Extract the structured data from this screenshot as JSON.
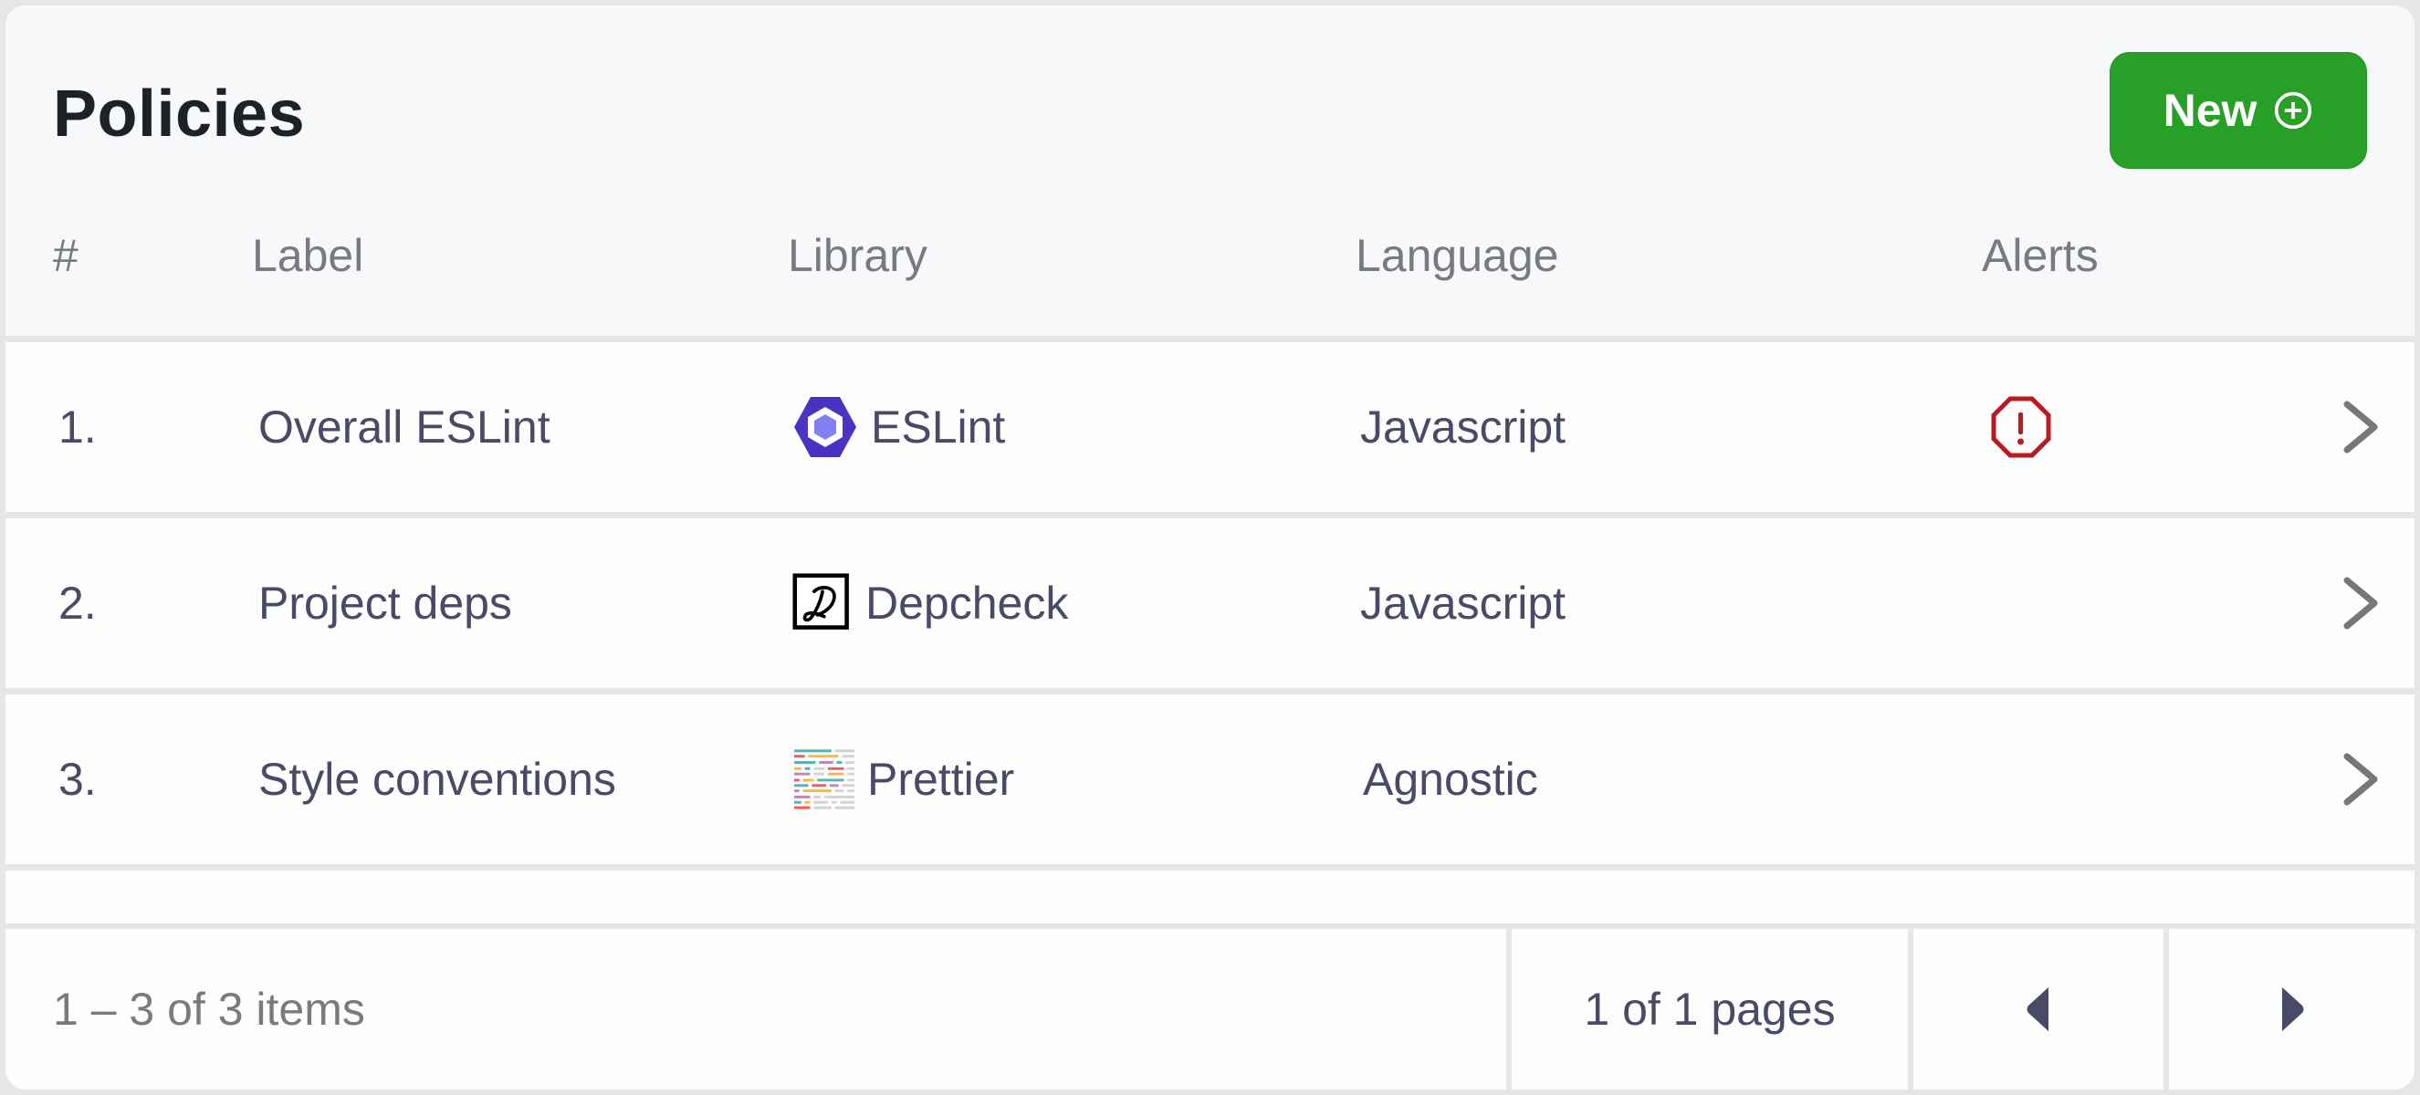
{
  "header": {
    "title": "Policies",
    "new_button_label": "New",
    "new_button_icon": "plus-circle-icon"
  },
  "columns": [
    "#",
    "Label",
    "Library",
    "Language",
    "Alerts"
  ],
  "rows": [
    {
      "index": "1.",
      "label": "Overall ESLint",
      "library": "ESLint",
      "library_icon": "eslint-logo-icon",
      "language": "Javascript",
      "alert": true,
      "alert_icon": "octagon-alert-icon"
    },
    {
      "index": "2.",
      "label": "Project deps",
      "library": "Depcheck",
      "library_icon": "depcheck-logo-icon",
      "language": "Javascript",
      "alert": false
    },
    {
      "index": "3.",
      "label": "Style conventions",
      "library": "Prettier",
      "library_icon": "prettier-logo-icon",
      "language": "Agnostic",
      "alert": false
    }
  ],
  "footer": {
    "items_summary": "1 – 3 of 3 items",
    "pages_summary": "1 of 1 pages",
    "prev_icon": "caret-left-icon",
    "next_icon": "caret-right-icon"
  },
  "colors": {
    "primary_button": "#28a028",
    "alert": "#b81c22",
    "eslint_outer": "#4b32c3",
    "eslint_inner": "#8080f2",
    "text": "#484a66",
    "muted": "#777a7e",
    "border": "#e6e6e6",
    "header_bg": "#f7f8fa"
  }
}
